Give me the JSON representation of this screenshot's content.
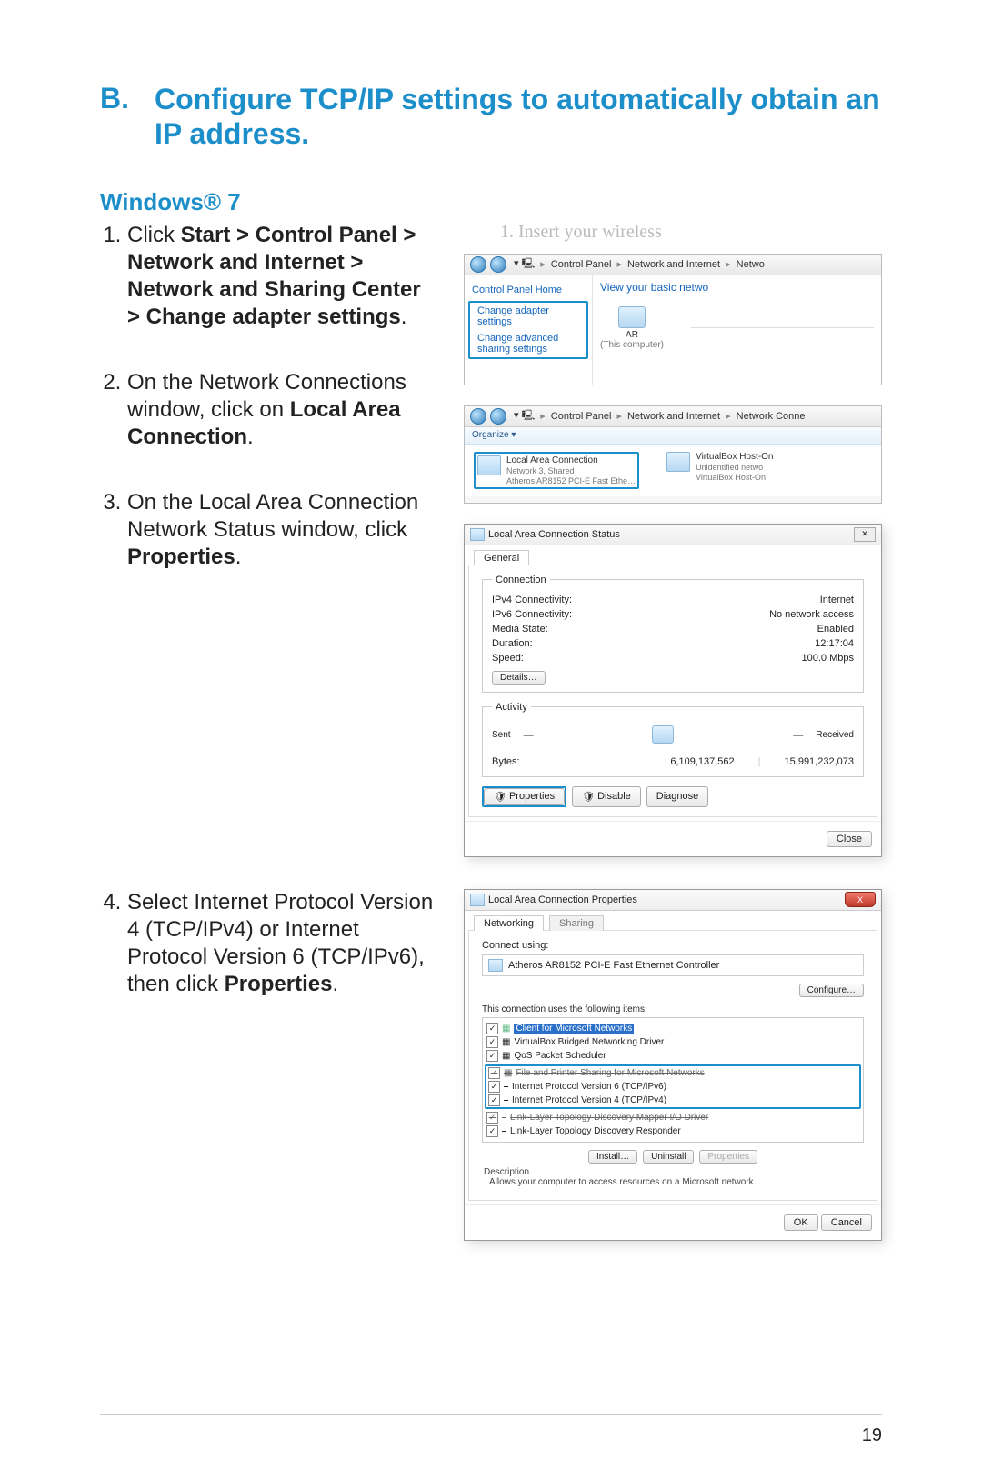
{
  "section": {
    "letter": "B.",
    "title": "Configure TCP/IP settings to automatically obtain an IP address."
  },
  "os_heading": "Windows® 7",
  "steps": {
    "s1_prefix": "Click ",
    "s1_bold": "Start > Control Panel > Network and Internet > Network and Sharing Center > Change adapter settings",
    "s1_suffix": ".",
    "s2_prefix": "On the Network Connections window, click on ",
    "s2_bold": "Local Area Connection",
    "s2_suffix": ".",
    "s3_prefix": "On the Local Area Connection Network Status window, click ",
    "s3_bold": "Properties",
    "s3_suffix": ".",
    "s4_prefix": "Select Internet Protocol Version 4 (TCP/IPv4) or Internet Protocol Version 6 (TCP/IPv6), then click ",
    "s4_bold": "Properties",
    "s4_suffix": "."
  },
  "shot1": {
    "ghost_heading": "1. Insert your wireless",
    "bc1": "Control Panel",
    "bc2": "Network and Internet",
    "bc3": "Netwo",
    "sb_head": "Control Panel Home",
    "sb_item1": "Change adapter settings",
    "sb_item2": "Change advanced sharing settings",
    "rp_title": "View your basic netwo",
    "node_label": "AR",
    "node_sub": "(This computer)"
  },
  "shot2": {
    "bc1": "Control Panel",
    "bc2": "Network and Internet",
    "bc3": "Network Conne",
    "organize": "Organize ▾",
    "conn1_title": "Local Area Connection",
    "conn1_sub": "Network 3, Shared",
    "conn1_adapter": "Atheros AR8152 PCI-E Fast Ethe…",
    "conn2_title": "VirtualBox Host-On",
    "conn2_sub": "Unidentified netwo",
    "conn2_adapter": "VirtualBox Host-On"
  },
  "shot3": {
    "title": "Local Area Connection Status",
    "tab_general": "General",
    "fs_conn": "Connection",
    "ipv4_label": "IPv4 Connectivity:",
    "ipv4_val": "Internet",
    "ipv6_label": "IPv6 Connectivity:",
    "ipv6_val": "No network access",
    "media_label": "Media State:",
    "media_val": "Enabled",
    "dur_label": "Duration:",
    "dur_val": "12:17:04",
    "speed_label": "Speed:",
    "speed_val": "100.0 Mbps",
    "details_btn": "Details…",
    "fs_activity": "Activity",
    "sent": "Sent",
    "recv": "Received",
    "bytes_label": "Bytes:",
    "bytes_sent": "6,109,137,562",
    "bytes_recv": "15,991,232,073",
    "btn_props": "Properties",
    "btn_disable": "Disable",
    "btn_diag": "Diagnose",
    "btn_close": "Close"
  },
  "shot4": {
    "title": "Local Area Connection Properties",
    "tab_net": "Networking",
    "tab_share": "Sharing",
    "connect_using": "Connect using:",
    "adapter": "Atheros AR8152 PCI-E Fast Ethernet Controller",
    "btn_conf": "Configure…",
    "list_label": "This connection uses the following items:",
    "items": [
      "Client for Microsoft Networks",
      "VirtualBox Bridged Networking Driver",
      "QoS Packet Scheduler",
      "File and Printer Sharing for Microsoft Networks",
      "Internet Protocol Version 6 (TCP/IPv6)",
      "Internet Protocol Version 4 (TCP/IPv4)",
      "Link-Layer Topology Discovery Mapper I/O Driver",
      "Link-Layer Topology Discovery Responder"
    ],
    "btn_install": "Install…",
    "btn_uninstall": "Uninstall",
    "btn_props": "Properties",
    "desc_head": "Description",
    "desc_body": "Allows your computer to access resources on a Microsoft network.",
    "btn_ok": "OK",
    "btn_cancel": "Cancel",
    "close_x": "X"
  },
  "page_number": "19"
}
